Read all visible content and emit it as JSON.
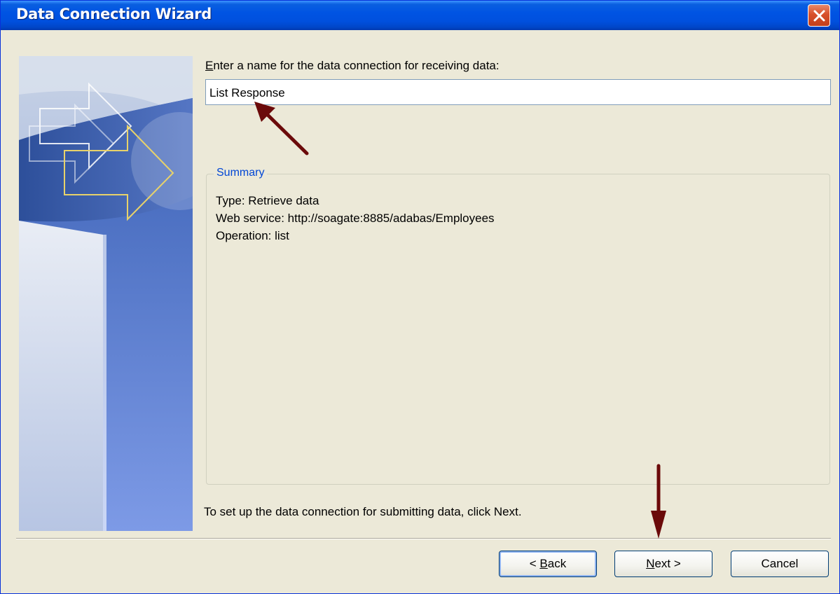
{
  "window": {
    "title": "Data Connection Wizard"
  },
  "form": {
    "prompt_mnemonic": "E",
    "prompt_rest": "nter a name for the data connection for receiving data:",
    "name_value": "List Response"
  },
  "summary": {
    "title": "Summary",
    "lines": [
      "Type: Retrieve data",
      "Web service: http://soagate:8885/adabas/Employees",
      "Operation: list"
    ]
  },
  "footer": {
    "instruction": "To set up the data connection for submitting data, click Next."
  },
  "buttons": {
    "back": {
      "prefix": "< ",
      "mnemonic": "B",
      "suffix": "ack"
    },
    "next": {
      "prefix": "",
      "mnemonic": "N",
      "suffix": "ext >"
    },
    "cancel": "Cancel"
  },
  "colors": {
    "title_bar": "#0054e3",
    "dialog_bg": "#ece9d8",
    "annotation_arrow": "#6b0a0a",
    "group_title": "#0046d5"
  },
  "icons": [
    "close-icon",
    "wizard-arrow-art",
    "annotation-arrow"
  ]
}
